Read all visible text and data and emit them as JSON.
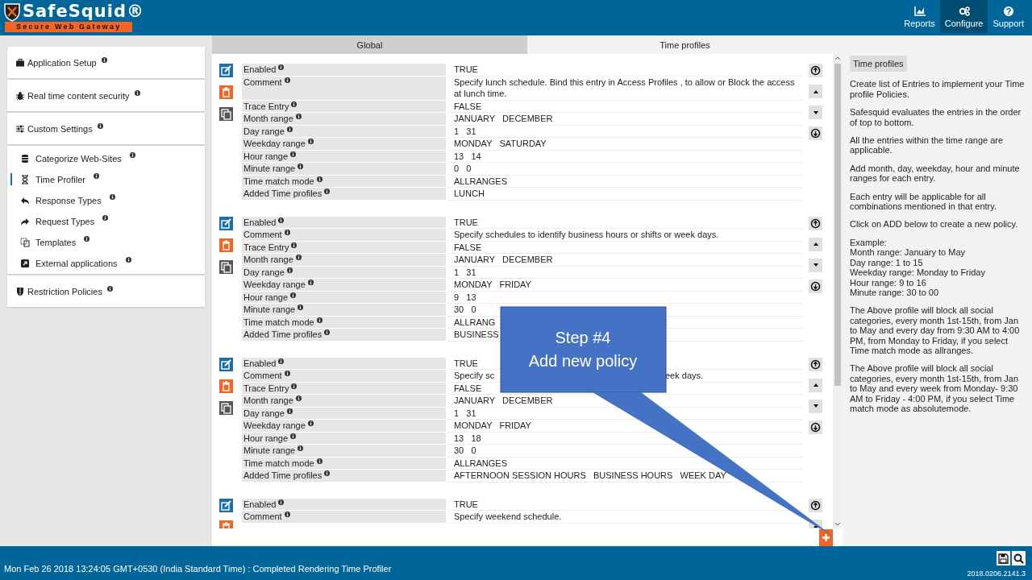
{
  "header": {
    "logo": {
      "name": "SafeSquid®",
      "tagline": "Secure Web Gateway"
    },
    "nav": [
      {
        "label": "Reports",
        "selected": false
      },
      {
        "label": "Configure",
        "selected": true
      },
      {
        "label": "Support",
        "selected": false
      }
    ]
  },
  "sidebar": {
    "groups": [
      {
        "items": [
          {
            "label": "Application Setup",
            "selected": false
          }
        ]
      },
      {
        "items": [
          {
            "label": "Real time content security",
            "selected": false
          }
        ]
      },
      {
        "items": [
          {
            "label": "Custom Settings",
            "selected": false
          }
        ]
      },
      {
        "items": [
          {
            "label": "Categorize Web-Sites",
            "selected": false
          },
          {
            "label": "Time Profiler",
            "selected": true
          },
          {
            "label": "Response Types",
            "selected": false
          },
          {
            "label": "Request Types",
            "selected": false
          },
          {
            "label": "Templates",
            "selected": false
          },
          {
            "label": "External applications",
            "selected": false
          }
        ]
      },
      {
        "items": [
          {
            "label": "Restriction Policies",
            "selected": false
          }
        ]
      }
    ]
  },
  "tabs": [
    {
      "label": "Global",
      "selected": false
    },
    {
      "label": "Time profiles",
      "selected": true
    }
  ],
  "entries": [
    {
      "fields": [
        {
          "label": "Enabled",
          "value": "TRUE"
        },
        {
          "label": "Comment",
          "value": "Specify lunch schedule. Bind this entry in Access Profiles , to allow or Block the access at lunch time."
        },
        {
          "label": "Trace Entry",
          "value": "FALSE"
        },
        {
          "label": "Month range",
          "value": "JANUARY   DECEMBER"
        },
        {
          "label": "Day range",
          "value": "1   31"
        },
        {
          "label": "Weekday range",
          "value": "MONDAY   SATURDAY"
        },
        {
          "label": "Hour range",
          "value": "13   14"
        },
        {
          "label": "Minute range",
          "value": "0   0"
        },
        {
          "label": "Time match mode",
          "value": "ALLRANGES"
        },
        {
          "label": "Added Time profiles",
          "value": "LUNCH"
        }
      ]
    },
    {
      "fields": [
        {
          "label": "Enabled",
          "value": "TRUE"
        },
        {
          "label": "Comment",
          "value": "Specify schedules to identify business hours or shifts or week days."
        },
        {
          "label": "Trace Entry",
          "value": "FALSE"
        },
        {
          "label": "Month range",
          "value": "JANUARY   DECEMBER"
        },
        {
          "label": "Day range",
          "value": "1   31"
        },
        {
          "label": "Weekday range",
          "value": "MONDAY   FRIDAY"
        },
        {
          "label": "Hour range",
          "value": "9   13"
        },
        {
          "label": "Minute range",
          "value": "30   0"
        },
        {
          "label": "Time match mode",
          "value": "ALLRANG"
        },
        {
          "label": "Added Time profiles",
          "value": "BUSINESS"
        }
      ]
    },
    {
      "fields": [
        {
          "label": "Enabled",
          "value": "TRUE"
        },
        {
          "label": "Comment",
          "parts": [
            "Specify sc",
            "eek days."
          ]
        },
        {
          "label": "Trace Entry",
          "value": "FALSE"
        },
        {
          "label": "Month range",
          "value": "JANUARY   DECEMBER"
        },
        {
          "label": "Day range",
          "value": "1   31"
        },
        {
          "label": "Weekday range",
          "value": "MONDAY   FRIDAY"
        },
        {
          "label": "Hour range",
          "value": "13   18"
        },
        {
          "label": "Minute range",
          "value": "30   0"
        },
        {
          "label": "Time match mode",
          "value": "ALLRANGES"
        },
        {
          "label": "Added Time profiles",
          "value": "AFTERNOON SESSION HOURS   BUSINESS HOURS   WEEK DAY"
        }
      ]
    },
    {
      "fields": [
        {
          "label": "Enabled",
          "value": "TRUE"
        },
        {
          "label": "Comment",
          "value": "Specify weekend schedule."
        }
      ]
    }
  ],
  "callout": {
    "lines": [
      "Step #4",
      "Add new policy"
    ]
  },
  "help": {
    "title": "Time profiles",
    "paragraphs": [
      [
        "Create list of Entries to implement your Time profile Policies."
      ],
      [
        "Safesquid evaluates the entries in the order of top to bottom."
      ],
      [
        "All the entries within the time range are applicable."
      ],
      [
        "Add month, day, weekday, hour and minute ranges for each entry."
      ],
      [
        "Each entry will be applicable for all combinations mentioned in that entry."
      ],
      [
        "Click on ADD below to create a new policy."
      ],
      [
        "Example:",
        "Month range: January to May",
        "Day range: 1 to 15",
        "Weekday range: Monday to Friday",
        "Hour range: 9 to 16",
        "Minute range: 30 to 00"
      ],
      [
        "The Above profile will block all social categories, every month 1st-15th, from Jan to May and every day from 9:30 AM to 4:00 PM, from Monday to Friday, if you select Time match mode as allranges."
      ],
      [
        "The Above profile will block all social categories, every month 1st-15th, from Jan to May and every week from Monday- 9:30 AM to Friday - 4:00 PM, if you select Time match mode as absolutemode."
      ]
    ]
  },
  "status_bar": {
    "message": "Mon Feb 26 2018 13:24:05 GMT+0530 (India Standard Time) : Completed Rendering Time Profiler",
    "version": "2018.0206.2141.3"
  }
}
